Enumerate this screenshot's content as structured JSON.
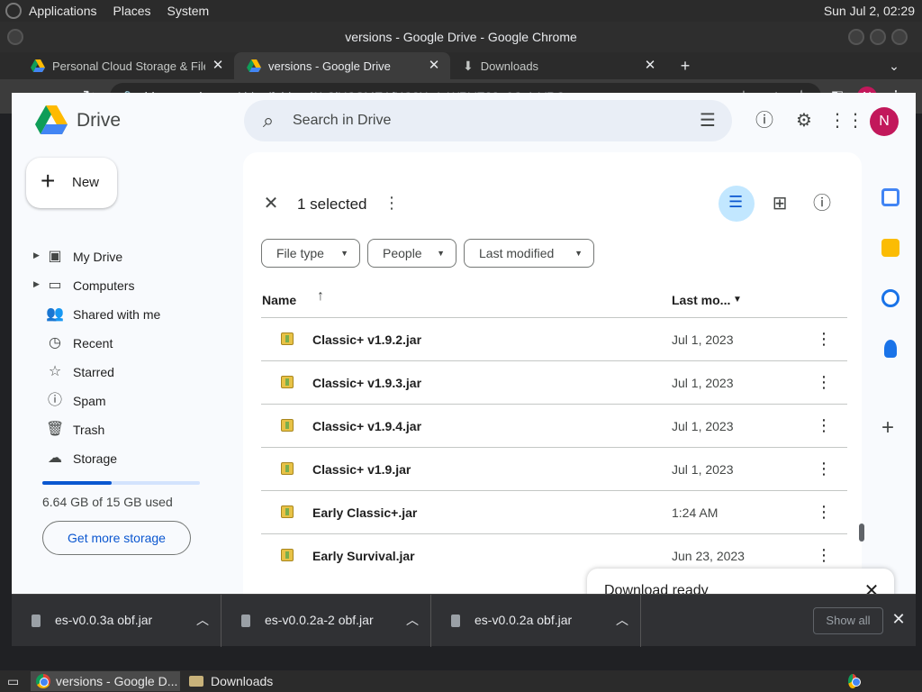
{
  "gnome_panel": {
    "menus": [
      "Applications",
      "Places",
      "System"
    ],
    "clock": "Sun Jul  2, 02:29"
  },
  "window": {
    "title": "versions - Google Drive - Google Chrome"
  },
  "tabs": [
    {
      "title": "Personal Cloud Storage & File",
      "icon": "google-drive-icon",
      "active": false
    },
    {
      "title": "versions - Google Drive",
      "icon": "google-drive-icon",
      "active": true
    },
    {
      "title": "Downloads",
      "icon": "download-icon",
      "active": false
    }
  ],
  "address_bar": {
    "host": "drive.google.com",
    "path": "/drive/folders/1LCjYCSMEAfXC8XwIpWRVE83a6Qr1-VRO",
    "profile_initial": "N"
  },
  "drive": {
    "logo_text": "Drive",
    "search_placeholder": "Search in Drive",
    "avatar_initial": "N",
    "new_button": "New",
    "nav": [
      {
        "label": "My Drive",
        "icon": "my-drive-icon",
        "expandable": true
      },
      {
        "label": "Computers",
        "icon": "computers-icon",
        "expandable": true
      },
      {
        "label": "Shared with me",
        "icon": "shared-icon",
        "expandable": false
      },
      {
        "label": "Recent",
        "icon": "clock-icon",
        "expandable": false
      },
      {
        "label": "Starred",
        "icon": "star-icon",
        "expandable": false
      },
      {
        "label": "Spam",
        "icon": "spam-icon",
        "expandable": false
      },
      {
        "label": "Trash",
        "icon": "trash-icon",
        "expandable": false
      },
      {
        "label": "Storage",
        "icon": "cloud-icon",
        "expandable": false
      }
    ],
    "storage": {
      "used_text": "6.64 GB of 15 GB used",
      "used_fraction": 0.4427,
      "more_button": "Get more storage"
    },
    "selection": {
      "count_text": "1 selected"
    },
    "filters": [
      "File type",
      "People",
      "Last modified"
    ],
    "columns": {
      "name": "Name",
      "modified": "Last mo..."
    },
    "files": [
      {
        "name": "Classic+ v1.9.2.jar",
        "modified": "Jul 1, 2023"
      },
      {
        "name": "Classic+ v1.9.3.jar",
        "modified": "Jul 1, 2023"
      },
      {
        "name": "Classic+ v1.9.4.jar",
        "modified": "Jul 1, 2023"
      },
      {
        "name": "Classic+ v1.9.jar",
        "modified": "Jul 1, 2023"
      },
      {
        "name": "Early Classic+.jar",
        "modified": "1:24 AM"
      },
      {
        "name": "Early Survival.jar",
        "modified": "Jun 23, 2023"
      }
    ],
    "download_toast": {
      "title": "Download ready"
    }
  },
  "downloads_shelf": {
    "items": [
      "es-v0.0.3a obf.jar",
      "es-v0.0.2a-2 obf.jar",
      "es-v0.0.2a obf.jar"
    ],
    "show_all": "Show all"
  },
  "taskbar": {
    "tasks": [
      {
        "title": "versions - Google D...",
        "icon": "chrome-icon"
      },
      {
        "title": "Downloads",
        "icon": "folder-icon"
      }
    ]
  },
  "colors": {
    "drive_blue": "#0b57d0",
    "selected_filter_bg": "#c2e7ff",
    "avatar": "#c2185b"
  }
}
